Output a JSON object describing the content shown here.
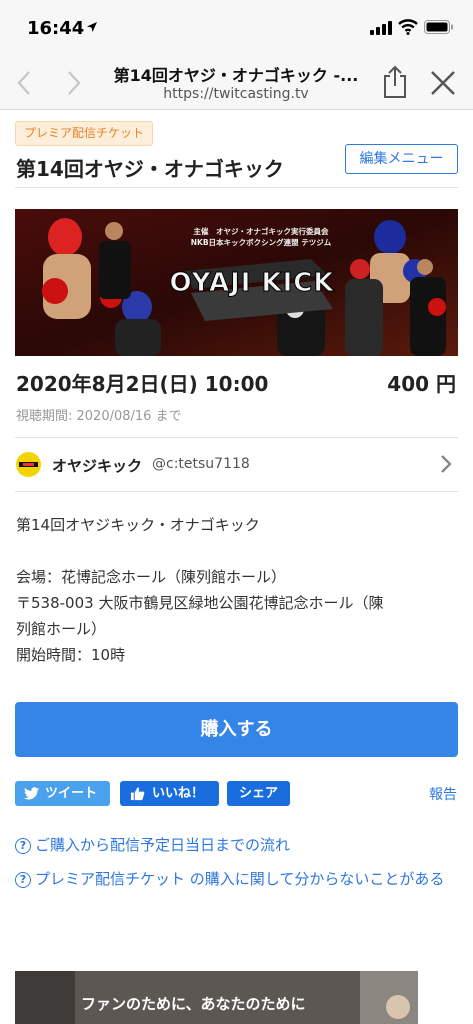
{
  "status_bar": {
    "time": "16:44"
  },
  "browser": {
    "title": "第14回オヤジ・オナゴキック -...",
    "url": "https://twitcasting.tv"
  },
  "ticket": {
    "badge": "プレミア配信チケット",
    "title": "第14回オヤジ・オナゴキック",
    "edit_menu_label": "編集メニュー",
    "banner": {
      "logo_text": "OYAJI KICK",
      "organizer_line1": "主催　オヤジ・オナゴキック実行委員会",
      "organizer_line2": "NKB日本キックボクシング連盟 テツジム"
    },
    "date": "2020年8月2日(日) 10:00",
    "price": "400 円",
    "viewing_period": "視聴期間: 2020/08/16 まで"
  },
  "broadcaster": {
    "name": "オヤジキック",
    "id": "@c:tetsu7118"
  },
  "description": [
    "第14回オヤジキック・オナゴキック",
    "",
    "会場：花博記念ホール（陳列館ホール）",
    "〒538-003 大阪市鶴見区緑地公園花博記念ホール（陳",
    "列館ホール）",
    "開始時間：10時"
  ],
  "actions": {
    "purchase_label": "購入する",
    "tweet_label": "ツイート",
    "like_label": "いいね！",
    "share_label": "シェア",
    "report_label": "報告"
  },
  "help": {
    "flow_link": "ご購入から配信予定日当日までの流れ",
    "faq_link": "プレミア配信チケット の購入に関して分からないことがある"
  },
  "promo": {
    "text": "ファンのために、あなたのために"
  },
  "colors": {
    "accent": "#3584e8",
    "link": "#2f78e0",
    "badge_text": "#e8832a",
    "badge_bg": "#fdeeda",
    "tweet": "#4aa2ee",
    "like": "#1a6ddc"
  },
  "icons": [
    "location-arrow-icon",
    "signal-icon",
    "wifi-icon",
    "battery-icon",
    "back-arrow-icon",
    "forward-arrow-icon",
    "share-icon",
    "close-icon",
    "chevron-right-icon",
    "twitter-bird-icon",
    "thumbs-up-icon",
    "help-circle-icon"
  ]
}
